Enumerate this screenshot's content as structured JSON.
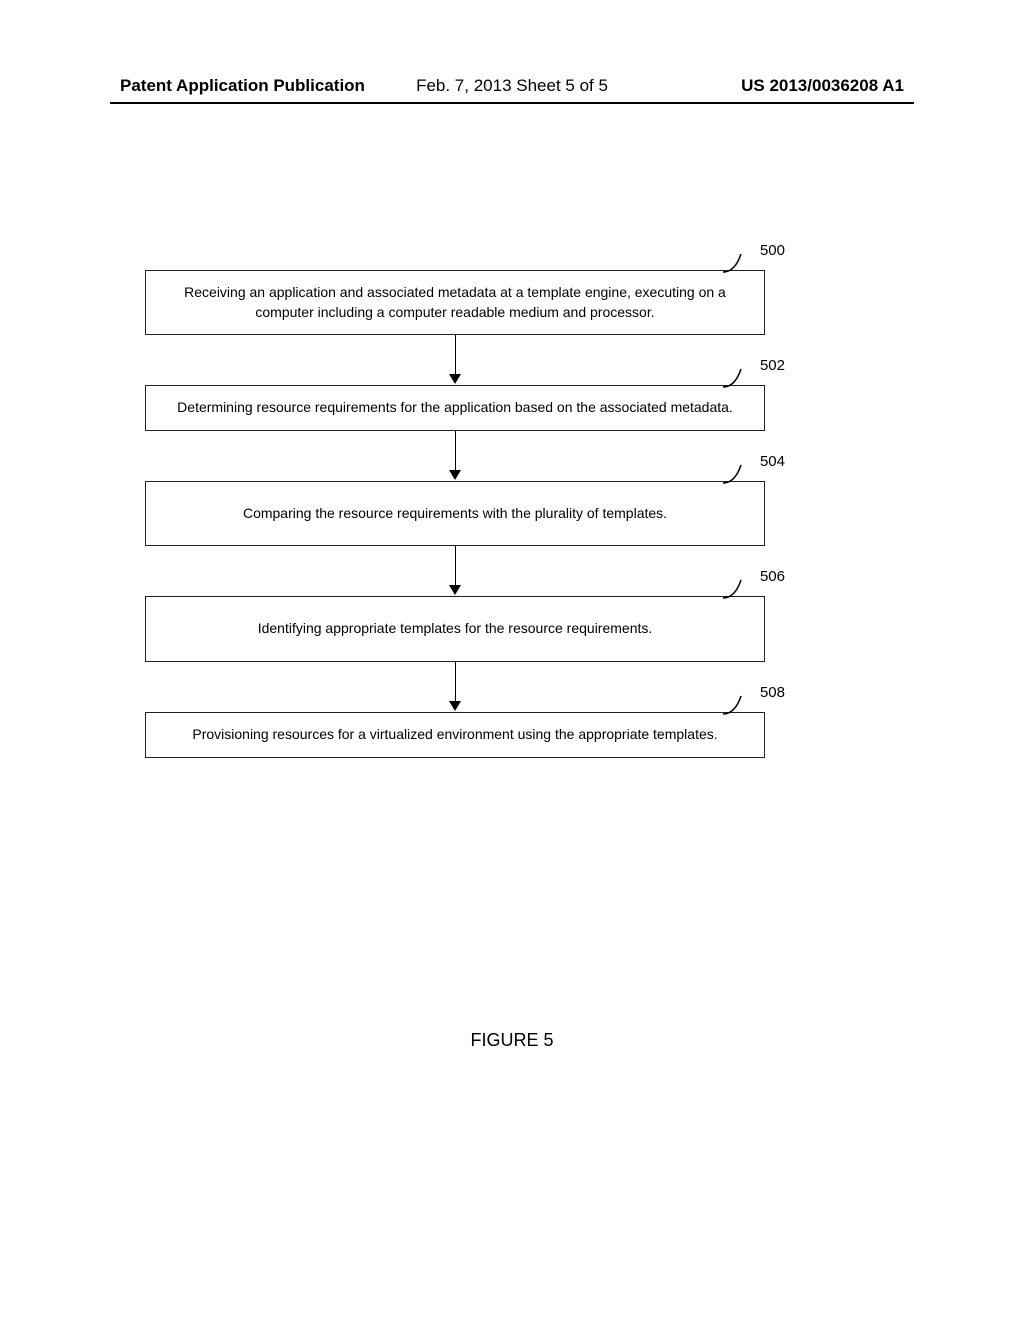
{
  "header": {
    "left": "Patent Application Publication",
    "center": "Feb. 7, 2013  Sheet 5 of 5",
    "right": "US 2013/0036208 A1"
  },
  "steps": [
    {
      "num": "500",
      "text": "Receiving an application and associated metadata at a template engine, executing on a computer including a computer readable medium and processor."
    },
    {
      "num": "502",
      "text": "Determining resource requirements for the application based on the associated metadata."
    },
    {
      "num": "504",
      "text": "Comparing the resource requirements with the plurality of templates."
    },
    {
      "num": "506",
      "text": "Identifying appropriate templates for the resource requirements."
    },
    {
      "num": "508",
      "text": "Provisioning resources for a virtualized environment using the appropriate templates."
    }
  ],
  "caption": "FIGURE 5"
}
